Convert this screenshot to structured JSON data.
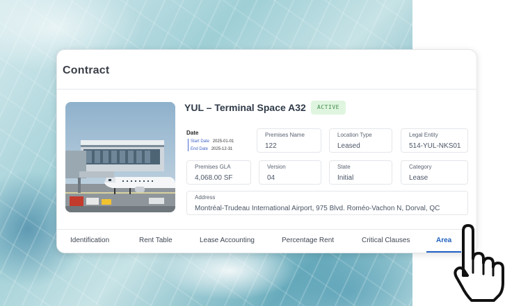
{
  "card": {
    "title": "Contract"
  },
  "contract": {
    "name": "YUL – Terminal Space A32",
    "status": "ACTIVE",
    "date": {
      "title": "Date",
      "start_label": "Start Date",
      "start_value": "2025-01-01",
      "end_label": "End Date",
      "end_value": "2025-12-31"
    },
    "fields": {
      "premises_name": {
        "label": "Premises Name",
        "value": "122"
      },
      "location_type": {
        "label": "Location Type",
        "value": "Leased"
      },
      "legal_entity": {
        "label": "Legal Entity",
        "value": "514-YUL-NKS01"
      },
      "premises_gla": {
        "label": "Premises GLA",
        "value": "4,068.00 SF"
      },
      "version": {
        "label": "Version",
        "value": "04"
      },
      "state": {
        "label": "State",
        "value": "Initial"
      },
      "category": {
        "label": "Category",
        "value": "Lease"
      },
      "address": {
        "label": "Address",
        "value": "Montréal-Trudeau International Airport, 975 Blvd. Roméo-Vachon N, Dorval, QC"
      }
    }
  },
  "tabs": [
    {
      "label": "Identification"
    },
    {
      "label": "Rent Table"
    },
    {
      "label": "Lease Accounting"
    },
    {
      "label": "Percentage Rent"
    },
    {
      "label": "Critical Clauses"
    },
    {
      "label": "Area"
    }
  ],
  "active_tab": "Area",
  "colors": {
    "accent": "#1f5fbf",
    "status_bg": "#dff5df",
    "status_text": "#3f8a4a"
  },
  "icons": {
    "cursor": "pointing-hand-icon"
  }
}
